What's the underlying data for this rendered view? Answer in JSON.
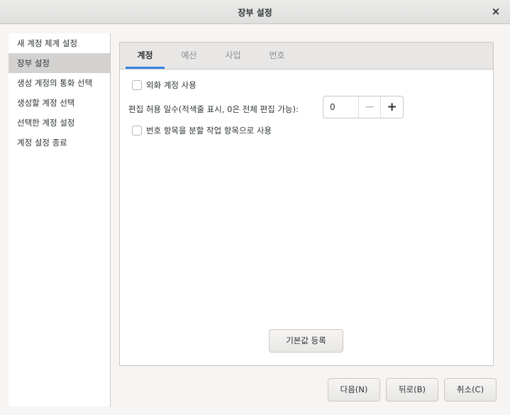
{
  "window": {
    "title": "장부 설정",
    "close_symbol": "×"
  },
  "sidebar": {
    "items": [
      {
        "label": "새 계정 체계 설정"
      },
      {
        "label": "장부 설정"
      },
      {
        "label": "생성 계정의 통화 선택"
      },
      {
        "label": "생성할 계정 선택"
      },
      {
        "label": "선택한 계정 설정"
      },
      {
        "label": "계정 설정 종료"
      }
    ],
    "selected": "장부 설정"
  },
  "tabs": [
    {
      "label": "계정"
    },
    {
      "label": "예산"
    },
    {
      "label": "사업"
    },
    {
      "label": "번호"
    }
  ],
  "active_tab": "계정",
  "accounts_tab": {
    "foreign_currency": {
      "label": "외화 계정 사용",
      "checked": false
    },
    "edit_days": {
      "label": "편집 허용 일수(적색줄 표시, 0은 전체 편집 가능):",
      "value": "0"
    },
    "split_action": {
      "label": "번호 항목을 분할 작업 항목으로 사용",
      "checked": false
    },
    "default_button": "기본값 등록"
  },
  "spin": {
    "minus_symbol": "−",
    "plus_symbol": "+"
  },
  "footer": {
    "next": "다음(N)",
    "back": "뒤로(B)",
    "cancel": "취소(C)"
  },
  "colors": {
    "accent": "#3584e4",
    "selected_row": "#d3d2d0"
  }
}
